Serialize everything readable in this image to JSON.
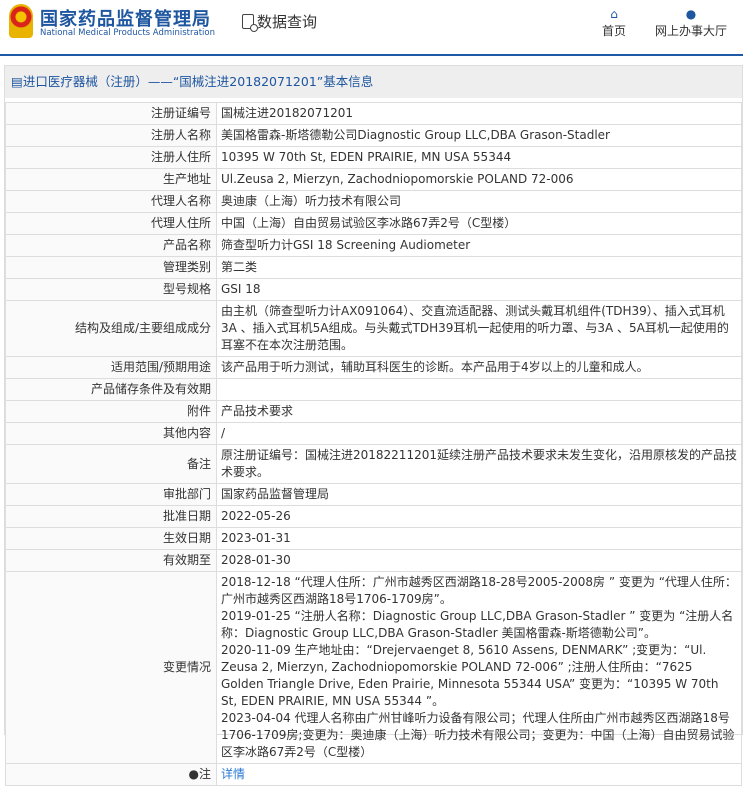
{
  "header": {
    "brand_cn": "国家药品监督管理局",
    "brand_en": "National Medical Products Administration",
    "data_query": "数据查询",
    "nav": [
      {
        "label": "首页",
        "icon": "home-icon"
      },
      {
        "label": "网上办事大厅",
        "icon": "user-icon"
      }
    ]
  },
  "panel_title": "进口医疗器械（注册）——“国械注进20182071201”基本信息",
  "rows": [
    {
      "label": "注册证编号",
      "value": "国械注进20182071201"
    },
    {
      "label": "注册人名称",
      "value": "美国格雷森-斯塔德勒公司Diagnostic Group LLC,DBA Grason-Stadler"
    },
    {
      "label": "注册人住所",
      "value": "10395 W 70th St, EDEN PRAIRIE, MN USA 55344"
    },
    {
      "label": "生产地址",
      "value": "Ul.Zeusa 2, Mierzyn, Zachodniopomorskie POLAND 72-006"
    },
    {
      "label": "代理人名称",
      "value": "奥迪康（上海）听力技术有限公司"
    },
    {
      "label": "代理人住所",
      "value": "中国（上海）自由贸易试验区李冰路67弄2号（C型楼）"
    },
    {
      "label": "产品名称",
      "value": "筛查型听力计GSI 18 Screening Audiometer"
    },
    {
      "label": "管理类别",
      "value": "第二类"
    },
    {
      "label": "型号规格",
      "value": "GSI 18"
    },
    {
      "label": "结构及组成/主要组成成分",
      "value": "由主机（筛查型听力计AX091064）、交直流适配器、测试头戴耳机组件(TDH39）、插入式耳机3A 、插入式耳机5A组成。与头戴式TDH39耳机一起使用的听力罩、与3A 、5A耳机一起使用的耳塞不在本次注册范围。"
    },
    {
      "label": "适用范围/预期用途",
      "value": "该产品用于听力测试，辅助耳科医生的诊断。本产品用于4岁以上的儿童和成人。"
    },
    {
      "label": "产品储存条件及有效期",
      "value": ""
    },
    {
      "label": "附件",
      "value": "产品技术要求"
    },
    {
      "label": "其他内容",
      "value": "/"
    },
    {
      "label": "备注",
      "value": "原注册证编号：国械注进20182211201延续注册产品技术要求未发生变化，沿用原核发的产品技术要求。"
    },
    {
      "label": "审批部门",
      "value": "国家药品监督管理局"
    },
    {
      "label": "批准日期",
      "value": "2022-05-26"
    },
    {
      "label": "生效日期",
      "value": "2023-01-31"
    },
    {
      "label": "有效期至",
      "value": "2028-01-30"
    }
  ],
  "changes": {
    "label": "变更情况",
    "items": [
      "2018-12-18 “代理人住所：广州市越秀区西湖路18-28号2005-2008房 ” 变更为 “代理人住所：广州市越秀区西湖路18号1706-1709房”。",
      "2019-01-25 “注册人名称：Diagnostic Group LLC,DBA Grason-Stadler ” 变更为 “注册人名称：Diagnostic Group LLC,DBA Grason-Stadler 美国格雷森-斯塔德勒公司”。",
      "2020-11-09 生产地址由：“Drejervaenget 8, 5610 Assens, DENMARK” ;变更为：“Ul. Zeusa 2, Mierzyn, Zachodniopomorskie POLAND 72-006” ;注册人住所由：“7625 Golden Triangle Drive, Eden Prairie, Minnesota 55344 USA” 变更为：“10395 W 70th St, EDEN PRAIRIE, MN USA 55344 ”。",
      "2023-04-04 代理人名称由广州甘峰听力设备有限公司；代理人住所由广州市越秀区西湖路18号1706-1709房;变更为：奥迪康（上海）听力技术有限公司；变更为：中国（上海）自由贸易试验区李冰路67弄2号（C型楼）"
    ]
  },
  "note": {
    "label": "注",
    "link": "详情"
  }
}
